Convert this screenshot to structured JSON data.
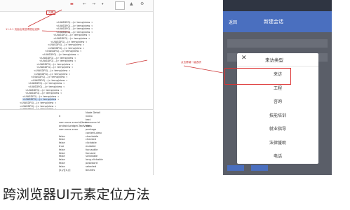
{
  "devtools": {
    "toolbar_counter": "",
    "toolbar_red_label": "元素",
    "annotation_left": "11.2.1 页面出现选项框后选择",
    "annotation_right": "点击跨端一级选项",
    "tree": [
      {
        "text": "<UIASDFG(...)> temp/view",
        "indent": 54
      },
      {
        "text": "<UIASDFG(...)> temp/view",
        "indent": 54
      },
      {
        "text": "<UIASDFG(...)> temp/view",
        "indent": 54
      },
      {
        "text": "<UIASDFG(...)> temp/view",
        "indent": 54
      },
      {
        "text": "<UIASDFG(...)> temp/view",
        "indent": 50
      },
      {
        "text": "<UIASDFG(...)> temp/view",
        "indent": 50
      },
      {
        "text": "<UIASDFG(...)> temp/view",
        "indent": 46
      },
      {
        "text": "<UIASDFG(...)> temp/view",
        "indent": 42
      },
      {
        "text": "<UIASDFG(...)> temp/view",
        "indent": 42
      },
      {
        "text": "<UIASDFG(...)> temp/view",
        "indent": 38
      },
      {
        "text": "<UIASDFG(...)> temp/view",
        "indent": 34
      },
      {
        "text": "<UIASDFG(...)> temp/view",
        "indent": 30
      },
      {
        "text": "<UIASDFG(...)> temp/view",
        "indent": 30
      },
      {
        "text": "<UIASDFG(...)> temp/view",
        "indent": 26
      },
      {
        "text": "<UIASDFG(...)> temp/view",
        "indent": 26
      },
      {
        "text": "<UIASDFG(...)> temp/view",
        "indent": 22
      },
      {
        "text": "<UIASDFG(...)> temp/view",
        "indent": 22
      },
      {
        "text": "<UIASDFG(...)> temp/view",
        "indent": 18
      },
      {
        "text": "<UIASDFG(...)> temp/view",
        "indent": 18
      },
      {
        "text": "<UIASDFG(...)> temp/view",
        "indent": 14
      },
      {
        "text": "<UIASDFG(...)> temp/view",
        "indent": 14
      },
      {
        "text": "<UIASDFG(...)> temp/view",
        "indent": 10
      },
      {
        "text": "<UIASDFG(...)> temp/view",
        "indent": 10
      },
      {
        "text": "<UIASDFG(...)> temp/view",
        "indent": 6
      },
      {
        "text": "<UIASDFG(...)> temp/view",
        "indent": 6
      },
      {
        "text": "<UIASDFG(...)> temp/view",
        "indent": 2
      },
      {
        "text": "<UIASDFG(...)> temp/view",
        "indent": 2
      },
      {
        "text": "<UIASDFG(...)> temp/view",
        "indent": 2
      },
      {
        "text": "<UIASDFG(...)> temp/view",
        "indent": 2
      }
    ],
    "props": [
      {
        "key": "Node Detail",
        "val": ""
      },
      {
        "key": "index",
        "val": "0"
      },
      {
        "key": "text",
        "val": ""
      },
      {
        "key": "resource-id",
        "val": "com.xxxx.xxxx:id/text"
      },
      {
        "key": "class",
        "val": "android.widget.TextView"
      },
      {
        "key": "package",
        "val": "com.xxxx.xxxx"
      },
      {
        "key": "content-desc",
        "val": ""
      },
      {
        "key": "checkable",
        "val": "false"
      },
      {
        "key": "checked",
        "val": "false"
      },
      {
        "key": "clickable",
        "val": "false"
      },
      {
        "key": "enabled",
        "val": "true"
      },
      {
        "key": "focusable",
        "val": "false"
      },
      {
        "key": "focused",
        "val": "false"
      },
      {
        "key": "scrollable",
        "val": "false"
      },
      {
        "key": "long-clickable",
        "val": "false"
      },
      {
        "key": "password",
        "val": "false"
      },
      {
        "key": "selected",
        "val": "false"
      },
      {
        "key": "bounds",
        "val": "[x,y][x,y]"
      }
    ]
  },
  "phone": {
    "status": "",
    "title": "新建会话",
    "left_nav": "返回",
    "modal_title": "来访类型",
    "close_glyph": "✕",
    "options": [
      "来访",
      "工程",
      "咨询",
      "技能培训",
      "就业指导",
      "法律援助",
      "电话"
    ]
  },
  "caption": "跨浏览器UI元素定位方法"
}
